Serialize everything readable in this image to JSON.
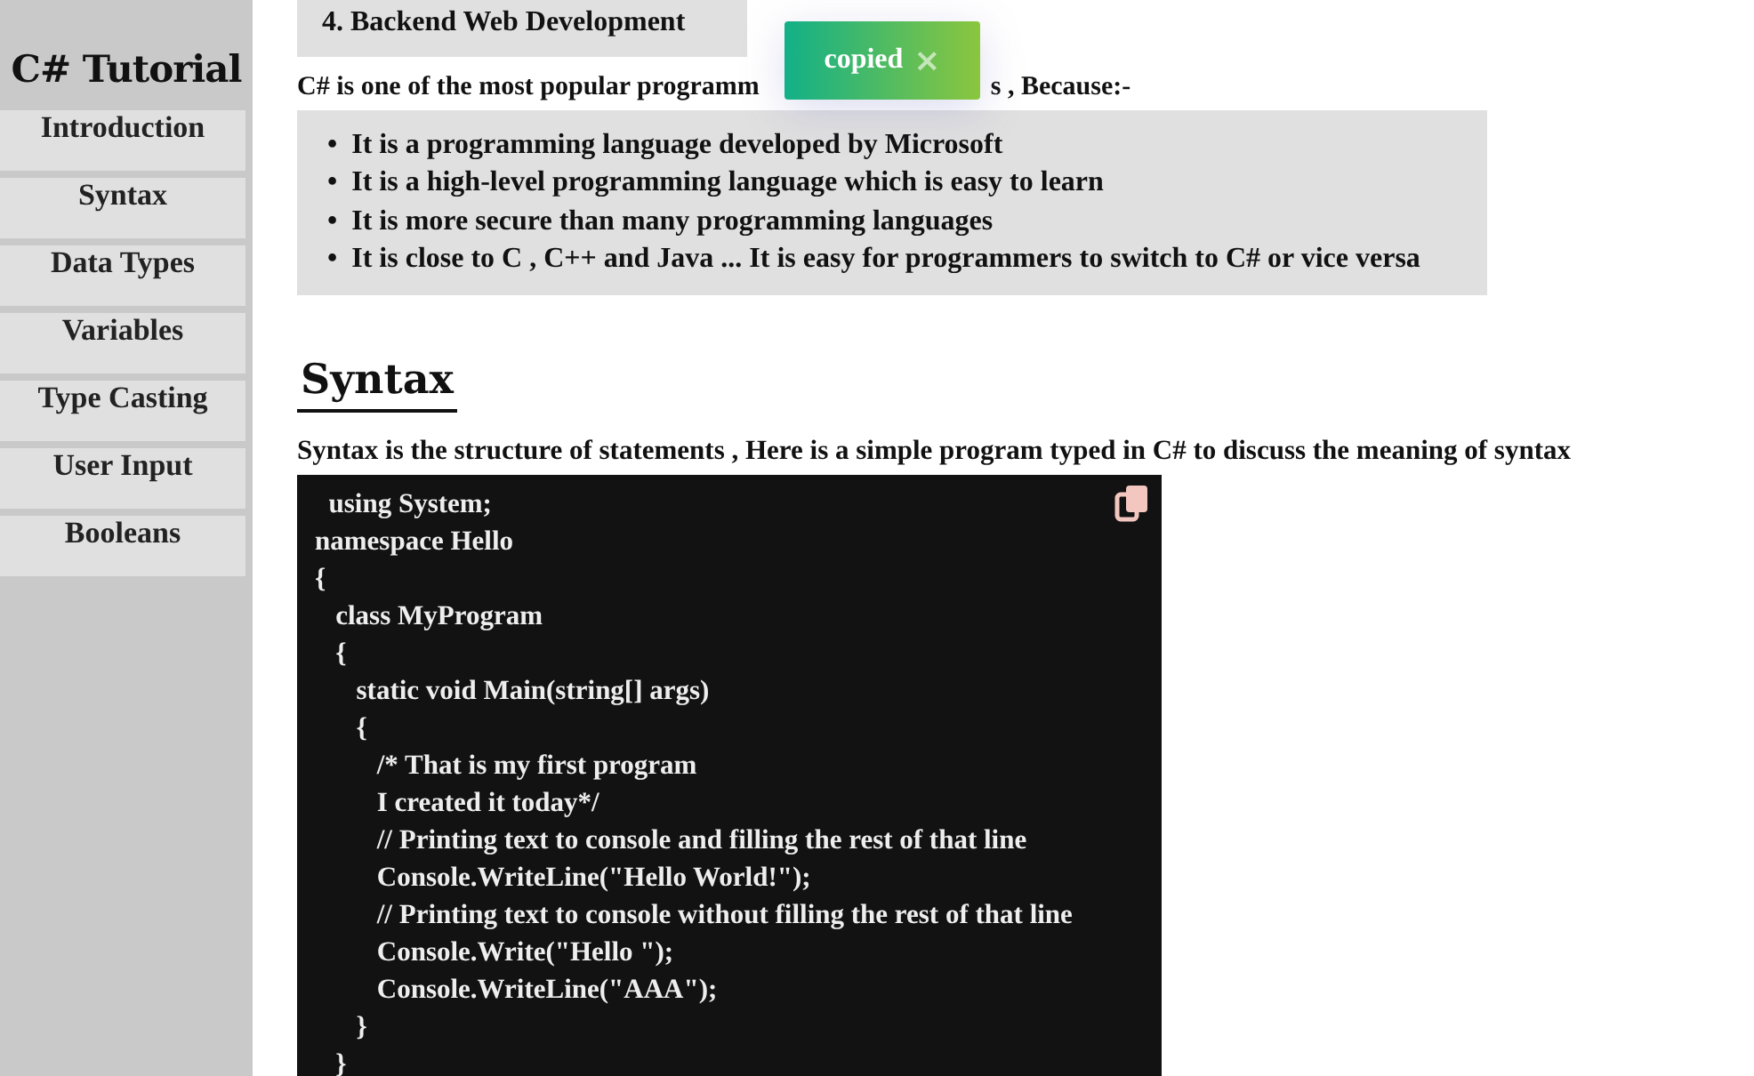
{
  "sidebar": {
    "title": "C# Tutorial",
    "items": [
      {
        "label": "Introduction"
      },
      {
        "label": "Syntax"
      },
      {
        "label": "Data Types"
      },
      {
        "label": "Variables"
      },
      {
        "label": "Type Casting"
      },
      {
        "label": "User Input"
      },
      {
        "label": "Booleans"
      }
    ]
  },
  "uses_list": {
    "last_item": "4. Backend Web Development"
  },
  "intro": {
    "visible_start": "C# is one of the most popular programm",
    "visible_end": "s , Because:-"
  },
  "reasons": [
    {
      "marker": "•",
      "text": "It is a programming language developed by Microsoft"
    },
    {
      "marker": "•",
      "text": "It is a high-level programming language which is easy to learn"
    },
    {
      "marker": "•",
      "text": "It is more secure than many programming languages"
    },
    {
      "marker": "•",
      "text": "It is close to C , C++ and Java ... It is easy for programmers to switch to C# or vice versa"
    }
  ],
  "section": {
    "heading": "Syntax",
    "description": "Syntax is the structure of statements , Here is a simple program typed in C# to discuss the meaning of syntax"
  },
  "code": {
    "lines": [
      "  using System;",
      "namespace Hello",
      "{",
      "   class MyProgram",
      "   {",
      "      static void Main(string[] args)",
      "      {",
      "         /* That is my first program",
      "         I created it today*/",
      "         // Printing text to console and filling the rest of that line",
      "         Console.WriteLine(\"Hello World!\");",
      "         // Printing text to console without filling the rest of that line",
      "         Console.Write(\"Hello \");",
      "         Console.WriteLine(\"AAA\");",
      "      }",
      "   }"
    ]
  },
  "toast": {
    "message": "copied",
    "close": "×"
  }
}
